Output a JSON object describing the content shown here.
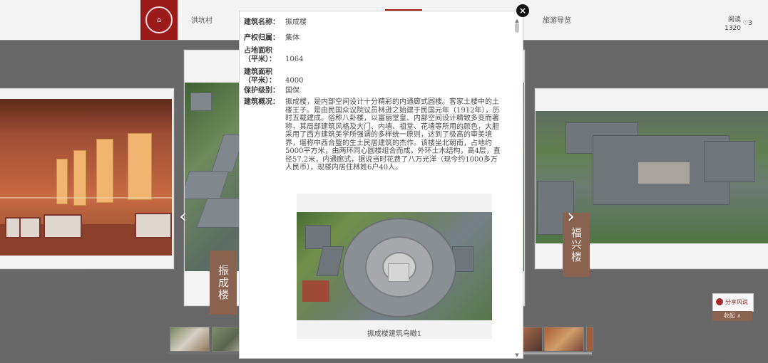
{
  "header": {
    "nav_items": [
      "洪坑村",
      "旅游导览"
    ],
    "reads_label": "阅读",
    "reads_count": "1320",
    "likes_text": "♡3"
  },
  "gallery": {
    "left_tab": "振成楼",
    "right_tab": "福兴楼"
  },
  "side_tools": {
    "share_label": "分享风说",
    "collapse_label": "收起 ∧"
  },
  "modal": {
    "fields": [
      {
        "label": "建筑名称：",
        "value": "振成楼"
      },
      {
        "label": "产权归属：",
        "value": "集体"
      },
      {
        "label": "占地面积（平米）：",
        "value": "1064"
      },
      {
        "label": "建筑面积（平米）：",
        "value": "4000"
      },
      {
        "label": "保护级别：",
        "value": "国保"
      },
      {
        "label": "建筑概况：",
        "value": "振成楼，是内部空间设计十分精彩的内通廊式圆楼。客家土楼中的土楼王子。是由民国众议院议员林逊之始建于民国元年（1912年），历时五载建成。俗称八卦楼，以富丽堂皇、内部空间设计精致多变而著称，其局部建筑风格及大门、内墙、祖堂、花墙等所用的颜色，大胆采用了西方建筑美学所强调的多样统一原则，达到了极高的审美境界，堪称中西合璧的生土民居建筑的杰作。该楼坐北朝南，占地约5000平方米，由两环同心圆楼组合而成。外环土木结构，高4层，直径57.2米，内通廊式，据说当时花费了八万光洋（现今约1000多万人民币），现楼内居住林姓6户40人。"
      }
    ],
    "image_caption": "振成楼建筑鸟瞰1"
  }
}
